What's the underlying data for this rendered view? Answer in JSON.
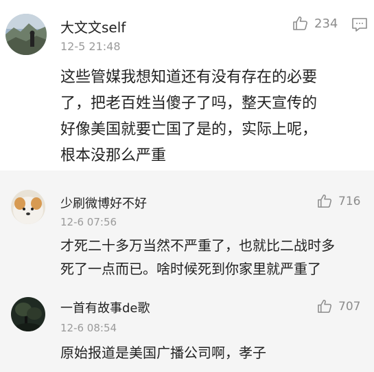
{
  "main_comment": {
    "username": "大文文self",
    "timestamp": "12-5 21:48",
    "likes": "234",
    "text_lines": [
      "这些管媒我想知道还有没有存在的必要",
      "了，把老百姓当傻子了吗，整天宣传的",
      "好像美国就要亡国了是的，实际上呢，",
      "根本没那么严重"
    ],
    "icons": {
      "like": "thumbs-up-icon",
      "reply": "comment-icon"
    }
  },
  "replies": [
    {
      "username": "少刷微博好不好",
      "timestamp": "12-6 07:56",
      "likes": "716",
      "text_lines": [
        "才死二十多万当然不严重了，也就比二战时多",
        "死了一点而已。啥时候死到你家里就严重了"
      ]
    },
    {
      "username": "一首有故事de歌",
      "timestamp": "12-6 08:54",
      "likes": "707",
      "text_lines": [
        "原始报道是美国广播公司啊，孝子"
      ]
    }
  ]
}
